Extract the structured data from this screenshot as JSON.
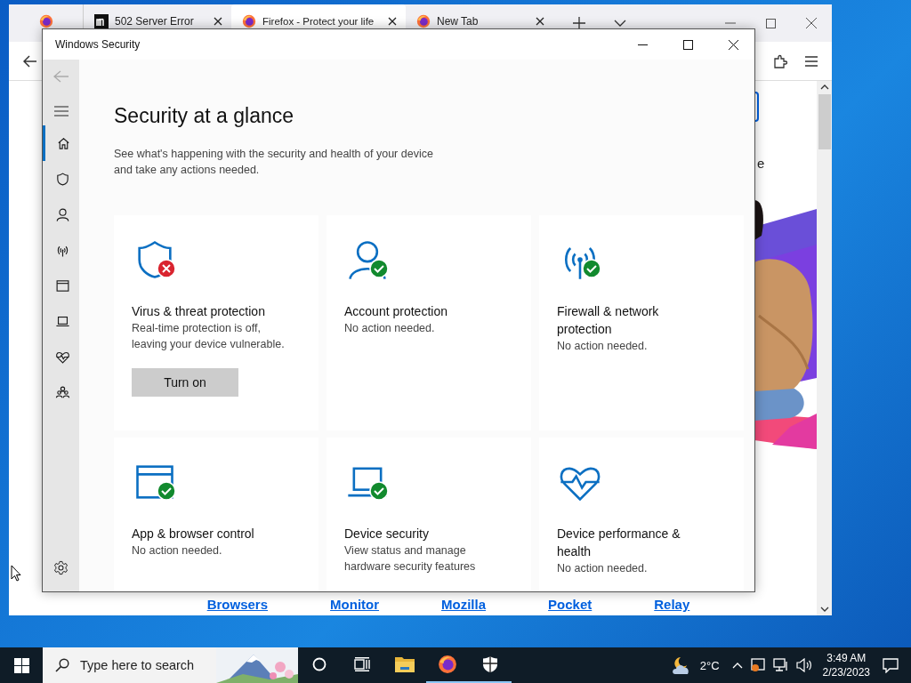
{
  "browser": {
    "tabs": [
      {
        "kind": "pinned",
        "selected": false
      },
      {
        "kind": "site",
        "title": "502 Server Error",
        "selected": false
      },
      {
        "kind": "firefox",
        "title": "Firefox - Protect your life",
        "selected": true
      },
      {
        "kind": "firefox",
        "title": "New Tab",
        "selected": false
      }
    ],
    "page_fragment": "e",
    "footer_links": [
      "Browsers",
      "Monitor",
      "Mozilla",
      "Pocket",
      "Relay"
    ]
  },
  "security": {
    "window": {
      "title": "Windows Security"
    },
    "nav": [
      {
        "kind": "home",
        "selected": true
      },
      {
        "kind": "shield",
        "selected": false
      },
      {
        "kind": "person",
        "selected": false
      },
      {
        "kind": "antenna",
        "selected": false
      },
      {
        "kind": "browser",
        "selected": false
      },
      {
        "kind": "laptop",
        "selected": false
      },
      {
        "kind": "heart",
        "selected": false
      },
      {
        "kind": "family",
        "selected": false
      }
    ],
    "heading": "Security at a glance",
    "description": "See what's happening with the security and health of your device and take any actions needed.",
    "tiles": [
      {
        "kind": "shield",
        "badge": true,
        "at_risk": true,
        "title": "Virus & threat protection",
        "description": "Real-time protection is off, leaving your device vulnerable.",
        "button": "Turn on"
      },
      {
        "kind": "person",
        "badge": true,
        "at_risk": false,
        "title": "Account protection",
        "description": "No action needed."
      },
      {
        "kind": "antenna",
        "badge": true,
        "at_risk": false,
        "title": "Firewall & network protection",
        "description": "No action needed."
      },
      {
        "kind": "browser",
        "badge": true,
        "at_risk": false,
        "title": "App & browser control",
        "description": "No action needed."
      },
      {
        "kind": "laptop",
        "badge": true,
        "at_risk": false,
        "title": "Device security",
        "description": "View status and manage hardware security features"
      },
      {
        "kind": "heart",
        "badge": false,
        "title": "Device performance & health",
        "description": "No action needed."
      }
    ]
  },
  "taskbar": {
    "search": {
      "placeholder": "Type here to search"
    },
    "apps": [
      {
        "kind": "cortana",
        "running": false
      },
      {
        "kind": "taskview",
        "running": false
      },
      {
        "kind": "explorer",
        "running": false
      },
      {
        "kind": "firefox",
        "running": true
      },
      {
        "kind": "security",
        "running": true
      }
    ],
    "weather": "2°C",
    "time": "3:49 AM",
    "date": "2/23/2023"
  }
}
